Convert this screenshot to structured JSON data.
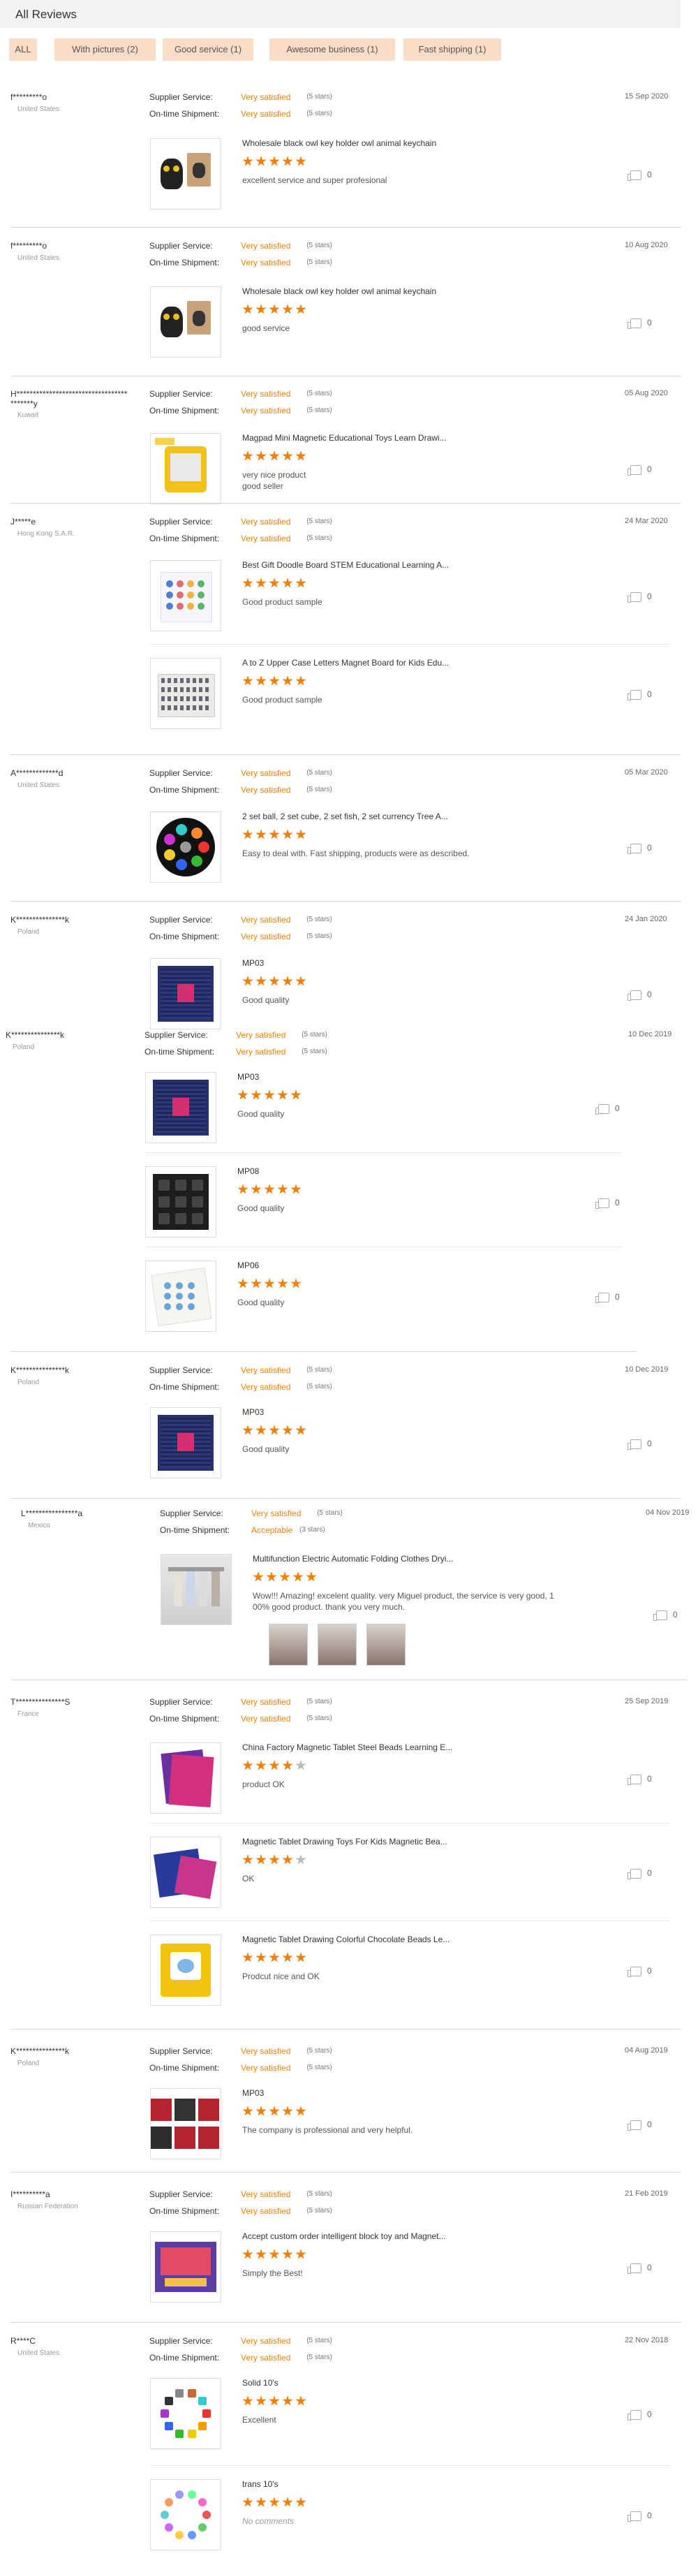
{
  "header": {
    "title": "All Reviews"
  },
  "filters": [
    "ALL",
    "With pictures (2)",
    "Good service (1)",
    "Awesome business (1)",
    "Fast shipping (1)"
  ],
  "labels": {
    "supplier": "Supplier Service:",
    "shipment": "On-time Shipment:"
  },
  "reviews": [
    {
      "user": "f*********o",
      "country": "United States",
      "date": "15 Sep 2020",
      "supplier_value": "Very satisfied",
      "supplier_stars": "(5 stars)",
      "shipment_value": "Very satisfied",
      "shipment_stars": "(5 stars)",
      "items": [
        {
          "product": "Wholesale black owl key holder owl animal keychain",
          "stars": 5,
          "comment": "excellent service and super profesional",
          "helpful": "0",
          "image": "owl-keychain"
        }
      ]
    },
    {
      "user": "f*********o",
      "country": "United States",
      "date": "10 Aug 2020",
      "supplier_value": "Very satisfied",
      "supplier_stars": "(5 stars)",
      "shipment_value": "Very satisfied",
      "shipment_stars": "(5 stars)",
      "items": [
        {
          "product": "Wholesale black owl key holder owl animal keychain",
          "stars": 5,
          "comment": "good service",
          "helpful": "0",
          "image": "owl-keychain"
        }
      ]
    },
    {
      "user": "H**********************************\n*******y",
      "country": "Kuwait",
      "date": "05 Aug 2020",
      "supplier_value": "Very satisfied",
      "supplier_stars": "(5 stars)",
      "shipment_value": "Very satisfied",
      "shipment_stars": "(5 stars)",
      "items": [
        {
          "product": "Magpad Mini Magnetic Educational Toys Learn Drawi...",
          "stars": 5,
          "comment": "very nice product\ngood seller",
          "helpful": "0",
          "image": "magpad-yellow"
        }
      ]
    },
    {
      "user": "J*****e",
      "country": "Hong Kong S.A.R.",
      "date": "24 Mar 2020",
      "supplier_value": "Very satisfied",
      "supplier_stars": "(5 stars)",
      "shipment_value": "Very satisfied",
      "shipment_stars": "(5 stars)",
      "items": [
        {
          "product": "Best Gift Doodle Board STEM Educational Learning A...",
          "stars": 5,
          "comment": "Good product sample",
          "helpful": "0",
          "image": "doodle-board"
        },
        {
          "product": "A to Z Upper Case Letters Magnet Board for Kids Edu...",
          "stars": 5,
          "comment": "Good product sample",
          "helpful": "0",
          "image": "letters-board"
        }
      ]
    },
    {
      "user": "A*************d",
      "country": "United States",
      "date": "05 Mar 2020",
      "supplier_value": "Very satisfied",
      "supplier_stars": "(5 stars)",
      "shipment_value": "Very satisfied",
      "shipment_stars": "(5 stars)",
      "items": [
        {
          "product": "2 set ball, 2 set cube, 2 set fish, 2 set currency Tree A...",
          "stars": 5,
          "comment": "Easy to deal with. Fast shipping, products were as described.",
          "helpful": "0",
          "image": "puzzle-set"
        }
      ]
    },
    {
      "user": "K***************k",
      "country": "Poland",
      "date": "24 Jan 2020",
      "supplier_value": "Very satisfied",
      "supplier_stars": "(5 stars)",
      "shipment_value": "Very satisfied",
      "shipment_stars": "(5 stars)",
      "items": [
        {
          "product": "MP03",
          "stars": 5,
          "comment": "Good quality",
          "helpful": "0",
          "image": "mp03"
        }
      ]
    },
    {
      "user": "K***************k",
      "country": "Poland",
      "date": "10 Dec 2019",
      "supplier_value": "Very satisfied",
      "supplier_stars": "(5 stars)",
      "shipment_value": "Very satisfied",
      "shipment_stars": "(5 stars)",
      "items": [
        {
          "product": "MP03",
          "stars": 5,
          "comment": "Good quality",
          "helpful": "0",
          "image": "mp03"
        },
        {
          "product": "MP08",
          "stars": 5,
          "comment": "Good quality",
          "helpful": "0",
          "image": "mp08"
        },
        {
          "product": "MP06",
          "stars": 5,
          "comment": "Good quality",
          "helpful": "0",
          "image": "mp06"
        }
      ]
    },
    {
      "user": "K***************k",
      "country": "Poland",
      "date": "10 Dec 2019",
      "supplier_value": "Very satisfied",
      "supplier_stars": "(5 stars)",
      "shipment_value": "Very satisfied",
      "shipment_stars": "(5 stars)",
      "items": [
        {
          "product": "MP03",
          "stars": 5,
          "comment": "Good quality",
          "helpful": "0",
          "image": "mp03"
        }
      ]
    },
    {
      "user": "L****************a",
      "country": "Mexico",
      "date": "04 Nov 2019",
      "supplier_value": "Very satisfied",
      "supplier_stars": "(5 stars)",
      "shipment_value": "Acceptable",
      "shipment_stars": "(3 stars)",
      "items": [
        {
          "product": "Multifunction Electric Automatic Folding Clothes Dryi...",
          "stars": 5,
          "comment": "Wow!!! Amazing! excelent quality. very Miguel product, the service is very good, 1\n00% good product. thank you very much.",
          "helpful": "0",
          "image": "clothes-dryer"
        }
      ]
    },
    {
      "user": "T***************S",
      "country": "France",
      "date": "25 Sep 2019",
      "supplier_value": "Very satisfied",
      "supplier_stars": "(5 stars)",
      "shipment_value": "Very satisfied",
      "shipment_stars": "(5 stars)",
      "items": [
        {
          "product": "China Factory Magnetic Tablet Steel Beads Learning E...",
          "stars": 4,
          "comment": "product OK",
          "helpful": "0",
          "image": "tablet-pink"
        },
        {
          "product": "Magnetic Tablet Drawing Toys For Kids Magnetic Bea...",
          "stars": 4,
          "comment": "OK",
          "helpful": "0",
          "image": "tablet-blue"
        },
        {
          "product": "Magnetic Tablet Drawing Colorful Chocolate Beads Le...",
          "stars": 5,
          "comment": "Prodcut nice and OK",
          "helpful": "0",
          "image": "tablet-yellow"
        }
      ]
    },
    {
      "user": "K***************k",
      "country": "Poland",
      "date": "04 Aug 2019",
      "supplier_value": "Very satisfied",
      "supplier_stars": "(5 stars)",
      "shipment_value": "Very satisfied",
      "shipment_stars": "(5 stars)",
      "items": [
        {
          "product": "MP03",
          "stars": 5,
          "comment": "The company is professional and very helpful.",
          "helpful": "0",
          "image": "mp03-set"
        }
      ]
    },
    {
      "user": "I**********a",
      "country": "Russian Federation",
      "date": "21 Feb 2019",
      "supplier_value": "Very satisfied",
      "supplier_stars": "(5 stars)",
      "shipment_value": "Very satisfied",
      "shipment_stars": "(5 stars)",
      "items": [
        {
          "product": "Accept custom order intelligent block toy and Magnet...",
          "stars": 5,
          "comment": "Simply the Best!",
          "helpful": "0",
          "image": "block-toy"
        }
      ]
    },
    {
      "user": "R****C",
      "country": "United States",
      "date": "22 Nov 2018",
      "supplier_value": "Very satisfied",
      "supplier_stars": "(5 stars)",
      "shipment_value": "Very satisfied",
      "shipment_stars": "(5 stars)",
      "items": [
        {
          "product": "Solid 10's",
          "stars": 5,
          "comment": "Excellent",
          "helpful": "0",
          "image": "solid-10s"
        },
        {
          "product": "trans 10's",
          "stars": 5,
          "comment": "No comments",
          "helpful": "0",
          "image": "trans-10s",
          "no_comment": true
        }
      ]
    }
  ]
}
